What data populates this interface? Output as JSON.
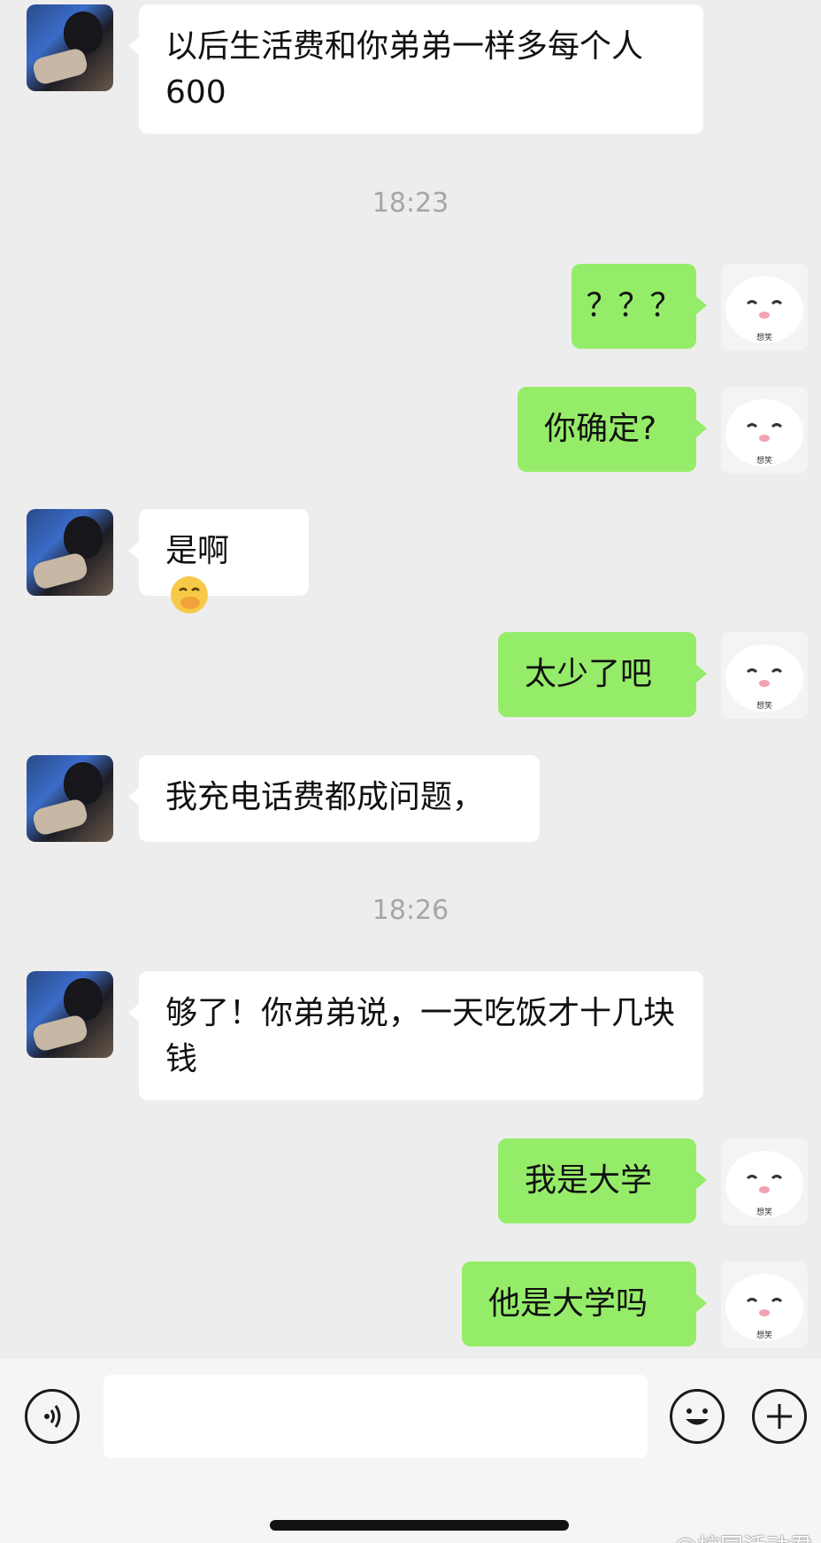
{
  "messages": [
    {
      "side": "left",
      "text": "以后生活费和你弟弟一样多每个人600"
    },
    {
      "side": "right",
      "text": "？？？"
    },
    {
      "side": "right",
      "text": "你确定?"
    },
    {
      "side": "left",
      "text": "是啊",
      "emoji": "thinking-face-emoji"
    },
    {
      "side": "right",
      "text": "太少了吧"
    },
    {
      "side": "left",
      "text": "我充电话费都成问题，"
    },
    {
      "side": "left",
      "text": "够了！你弟弟说，一天吃饭才十几块钱"
    },
    {
      "side": "right",
      "text": "我是大学"
    },
    {
      "side": "right",
      "text": "他是大学吗"
    }
  ],
  "timestamps": [
    "18:23",
    "18:26"
  ],
  "avatar_sticker_caption": "想笑",
  "input": {
    "value": "",
    "placeholder": ""
  },
  "icons": {
    "voice": "voice-icon",
    "emoji": "emoji-icon",
    "more": "plus-icon"
  },
  "watermark": "@校园活动君",
  "colors": {
    "background": "#ededed",
    "incoming_bubble": "#ffffff",
    "outgoing_bubble": "#95ec69",
    "timestamp": "#a6a6a6"
  }
}
